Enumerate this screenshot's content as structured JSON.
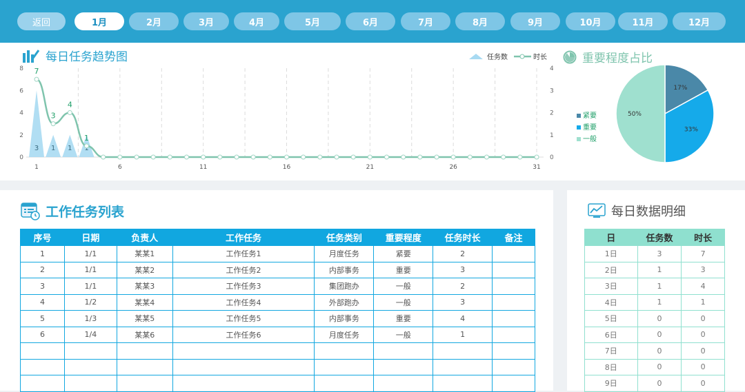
{
  "nav": {
    "back_label": "返回",
    "months": [
      "1月",
      "2月",
      "3月",
      "4月",
      "5月",
      "6月",
      "7月",
      "8月",
      "9月",
      "10月",
      "11月",
      "12月"
    ],
    "active_month": "1月"
  },
  "trend": {
    "title": "每日任务趋势图",
    "legend_tasks": "任务数",
    "legend_duration": "时长"
  },
  "importance": {
    "title": "重要程度占比"
  },
  "task_list": {
    "title": "工作任务列表",
    "columns": [
      "序号",
      "日期",
      "负责人",
      "工作任务",
      "任务类别",
      "重要程度",
      "任务时长",
      "备注"
    ],
    "rows": [
      [
        "1",
        "1/1",
        "某某1",
        "工作任务1",
        "月度任务",
        "紧要",
        "2",
        ""
      ],
      [
        "2",
        "1/1",
        "某某2",
        "工作任务2",
        "内部事务",
        "重要",
        "3",
        ""
      ],
      [
        "3",
        "1/1",
        "某某3",
        "工作任务3",
        "集团跑办",
        "一般",
        "2",
        ""
      ],
      [
        "4",
        "1/2",
        "某某4",
        "工作任务4",
        "外部跑办",
        "一般",
        "3",
        ""
      ],
      [
        "5",
        "1/3",
        "某某5",
        "工作任务5",
        "内部事务",
        "重要",
        "4",
        ""
      ],
      [
        "6",
        "1/4",
        "某某6",
        "工作任务6",
        "月度任务",
        "一般",
        "1",
        ""
      ],
      [
        "",
        "",
        "",
        "",
        "",
        "",
        "",
        ""
      ],
      [
        "",
        "",
        "",
        "",
        "",
        "",
        "",
        ""
      ],
      [
        "",
        "",
        "",
        "",
        "",
        "",
        "",
        ""
      ]
    ]
  },
  "daily_detail": {
    "title": "每日数据明细",
    "columns": [
      "日",
      "任务数",
      "时长"
    ],
    "rows": [
      [
        "1日",
        "3",
        "7"
      ],
      [
        "2日",
        "1",
        "3"
      ],
      [
        "3日",
        "1",
        "4"
      ],
      [
        "4日",
        "1",
        "1"
      ],
      [
        "5日",
        "0",
        "0"
      ],
      [
        "6日",
        "0",
        "0"
      ],
      [
        "7日",
        "0",
        "0"
      ],
      [
        "8日",
        "0",
        "0"
      ],
      [
        "9日",
        "0",
        "0"
      ]
    ]
  },
  "chart_data": [
    {
      "type": "area",
      "title": "每日任务趋势图",
      "x": [
        1,
        2,
        3,
        4,
        5,
        6,
        7,
        8,
        9,
        10,
        11,
        12,
        13,
        14,
        15,
        16,
        17,
        18,
        19,
        20,
        21,
        22,
        23,
        24,
        25,
        26,
        27,
        28,
        29,
        30,
        31
      ],
      "x_tick_labels": [
        "1",
        "6",
        "11",
        "16",
        "21",
        "26",
        "31"
      ],
      "y_left_ticks": [
        "0",
        "2",
        "4",
        "6",
        "8"
      ],
      "y_right_ticks": [
        "0",
        "1",
        "2",
        "3",
        "4"
      ],
      "ylim_left": [
        0,
        8
      ],
      "ylim_right": [
        0,
        4
      ],
      "series": [
        {
          "name": "任务数",
          "kind": "area",
          "axis": "right",
          "values": [
            3,
            1,
            1,
            1,
            0,
            0,
            0,
            0,
            0,
            0,
            0,
            0,
            0,
            0,
            0,
            0,
            0,
            0,
            0,
            0,
            0,
            0,
            0,
            0,
            0,
            0,
            0,
            0,
            0,
            0,
            0
          ],
          "color": "#a8daf2"
        },
        {
          "name": "时长",
          "kind": "line",
          "axis": "left",
          "values": [
            7,
            3,
            4,
            1,
            0,
            0,
            0,
            0,
            0,
            0,
            0,
            0,
            0,
            0,
            0,
            0,
            0,
            0,
            0,
            0,
            0,
            0,
            0,
            0,
            0,
            0,
            0,
            0,
            0,
            0,
            0
          ],
          "color": "#7fc4ad"
        }
      ],
      "data_labels_tasks": [
        "3",
        "1",
        "1",
        "1"
      ],
      "data_labels_duration": [
        "7",
        "3",
        "4",
        "1"
      ],
      "legend": "top-right",
      "grid": "vertical dashed"
    },
    {
      "type": "pie",
      "title": "重要程度占比",
      "categories": [
        "紧要",
        "重要",
        "一般"
      ],
      "values": [
        17,
        33,
        50
      ],
      "labels": [
        "17%",
        "33%",
        "50%"
      ],
      "colors": [
        "#4a88a8",
        "#15aaea",
        "#9fe0cf"
      ],
      "legend": "left"
    }
  ]
}
